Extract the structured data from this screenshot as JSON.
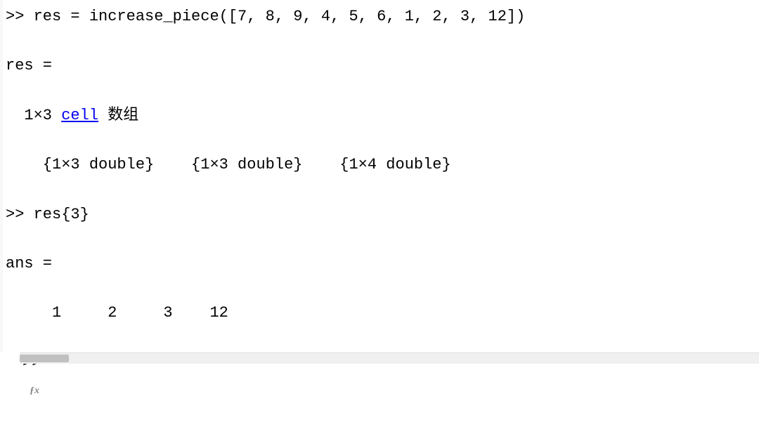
{
  "cmd1_prompt": ">> ",
  "cmd1": "res = increase_piece([7, 8, 9, 4, 5, 6, 1, 2, 3, 12])",
  "res_header": "res =",
  "res_desc_prefix": "  1×3 ",
  "res_desc_link": "cell",
  "res_desc_suffix": " 数组",
  "cells_line": "    {1×3 double}    {1×3 double}    {1×4 double}",
  "cmd2_prompt": ">> ",
  "cmd2": "res{3}",
  "ans_header": "ans =",
  "ans_values": "     1     2     3    12",
  "final_prompt": ">> "
}
